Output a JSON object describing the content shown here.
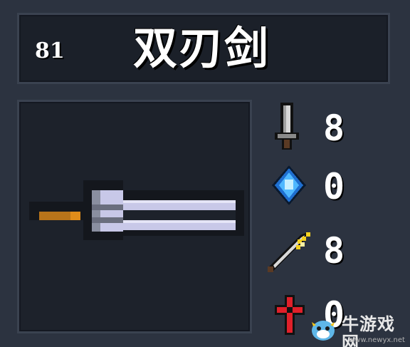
{
  "item": {
    "id": "81",
    "name": "双刃剑"
  },
  "stats": [
    {
      "icon": "dagger-damage-icon",
      "value": "8"
    },
    {
      "icon": "blue-energy-crystal-icon",
      "value": "0"
    },
    {
      "icon": "sword-critical-icon",
      "value": "8"
    },
    {
      "icon": "red-crosshair-accuracy-icon",
      "value": "0"
    }
  ],
  "watermark": {
    "text": "牛游戏网",
    "url": "www.newyx.net"
  },
  "colors": {
    "background": "#2c3340",
    "panel": "#1b2029",
    "blade": "#c8c8e8",
    "hilt": "#e08c1a",
    "crystal": "#4fb8ff",
    "crosshair": "#e0202a"
  }
}
